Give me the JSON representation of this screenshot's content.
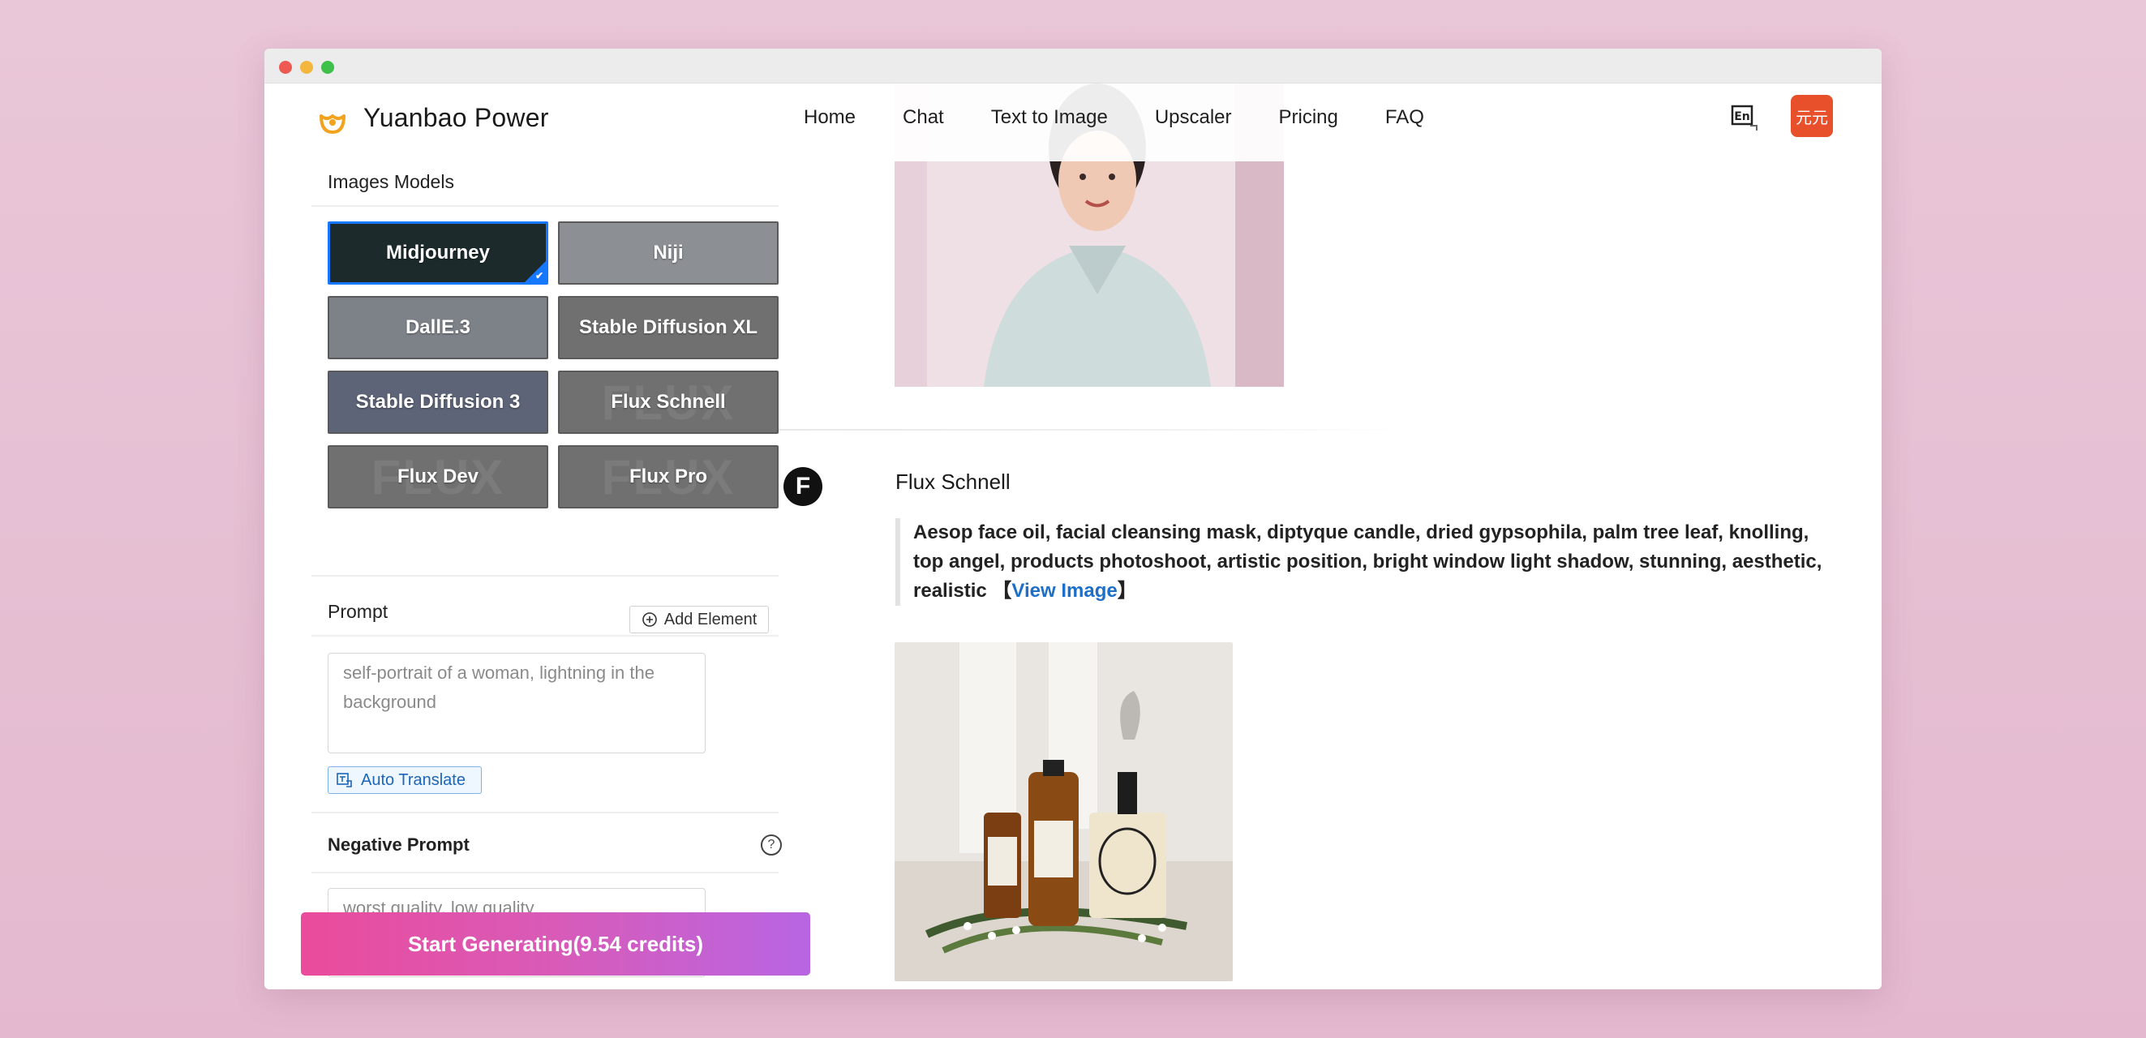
{
  "app": {
    "brand": "Yuanbao Power",
    "avatar_text": "元元",
    "lang_icon_text": "En"
  },
  "nav": {
    "items": [
      "Home",
      "Chat",
      "Text to Image",
      "Upscaler",
      "Pricing",
      "FAQ"
    ]
  },
  "sidebar": {
    "images_models_title": "Images Models",
    "models": [
      {
        "label": "Midjourney",
        "selected": true
      },
      {
        "label": "Niji",
        "selected": false
      },
      {
        "label": "DallE.3",
        "selected": false
      },
      {
        "label": "Stable Diffusion XL",
        "selected": false
      },
      {
        "label": "Stable Diffusion 3",
        "selected": false
      },
      {
        "label": "Flux Schnell",
        "selected": false
      },
      {
        "label": "Flux Dev",
        "selected": false
      },
      {
        "label": "Flux Pro",
        "selected": false
      }
    ],
    "prompt_title": "Prompt",
    "add_element_label": "Add Element",
    "prompt_placeholder": "self-portrait of a woman, lightning in the background",
    "auto_translate_label": "Auto Translate",
    "negative_prompt_title": "Negative Prompt",
    "negative_prompt_placeholder": "worst quality, low quality",
    "start_button_label": "Start Generating(9.54 credits)"
  },
  "main": {
    "result": {
      "model_name": "Flux Schnell",
      "model_avatar_letter": "F",
      "prompt_text": "Aesop face oil, facial cleansing mask, diptyque candle, dried gypsophila, palm tree leaf, knolling, top angel, products photoshoot, artistic position, bright window light shadow, stunning, aesthetic, realistic",
      "view_image_prefix": "【",
      "view_image_label": "View Image",
      "view_image_suffix": "】"
    }
  },
  "colors": {
    "accent_blue": "#1677ff",
    "link_blue": "#1e6fc8",
    "button_gradient_start": "#ea4b9b",
    "button_gradient_end": "#b865e3",
    "avatar_orange": "#e8502b",
    "page_background": "#e9c6d8"
  },
  "icons": [
    "logo-icon",
    "language-icon",
    "add-element-icon",
    "translate-icon",
    "help-icon",
    "flux-model-icon"
  ]
}
